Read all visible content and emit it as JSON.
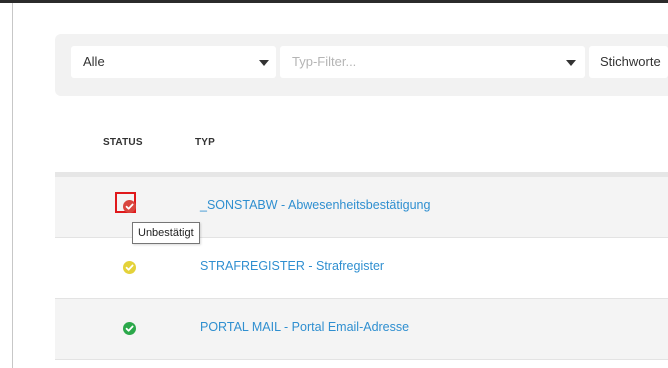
{
  "filters": {
    "status_value": "Alle",
    "type_placeholder": "Typ-Filter...",
    "keywords_value": "Stichworte"
  },
  "table": {
    "headers": {
      "status": "STATUS",
      "typ": "TYP"
    },
    "rows": [
      {
        "status": "unconfirmed",
        "status_color": "#d9463e",
        "type": "_SONSTABW - Abwesenheitsbestätigung"
      },
      {
        "status": "pending",
        "status_color": "#e4d23a",
        "type": "STRAFREGISTER - Strafregister"
      },
      {
        "status": "confirmed",
        "status_color": "#2ba84a",
        "type": "PORTAL MAIL - Portal Email-Adresse"
      }
    ]
  },
  "tooltip": {
    "text": "Unbestätigt"
  },
  "colors": {
    "link": "#2f8fd0",
    "highlight": "#e0181b"
  }
}
